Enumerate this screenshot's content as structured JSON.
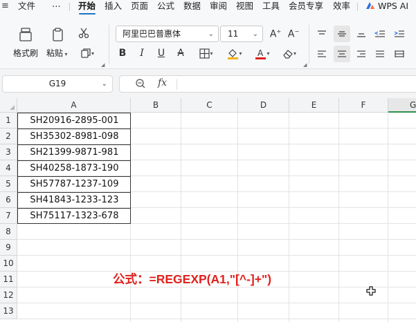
{
  "menu": {
    "items": [
      {
        "key": "file",
        "label": "文件"
      },
      {
        "key": "more",
        "label": "⋯"
      },
      {
        "key": "home",
        "label": "开始"
      },
      {
        "key": "insert",
        "label": "插入"
      },
      {
        "key": "page",
        "label": "页面"
      },
      {
        "key": "formula",
        "label": "公式"
      },
      {
        "key": "data",
        "label": "数据"
      },
      {
        "key": "review",
        "label": "审阅"
      },
      {
        "key": "view",
        "label": "视图"
      },
      {
        "key": "tools",
        "label": "工具"
      },
      {
        "key": "member",
        "label": "会员专享"
      },
      {
        "key": "efficiency",
        "label": "效率"
      },
      {
        "key": "wpsai",
        "label": "WPS AI"
      }
    ],
    "active": "开始"
  },
  "ribbon": {
    "format_painter": "格式刷",
    "paste": "粘贴",
    "font_name": "阿里巴巴普惠体",
    "font_size": "11",
    "accent_underline": "#1a73c9",
    "font_color": "#e0201b",
    "highlight_color": "#f3b11b"
  },
  "formula_bar": {
    "cell_ref": "G19",
    "fx_label": "fx",
    "formula": ""
  },
  "sheet": {
    "columns": [
      "A",
      "B",
      "C",
      "D",
      "E",
      "F",
      "G"
    ],
    "rows": [
      "1",
      "2",
      "3",
      "4",
      "5",
      "6",
      "7",
      "8",
      "9",
      "10",
      "11",
      "12",
      "13"
    ],
    "cells_A": [
      "SH20916-2895-001",
      "SH35302-8981-098",
      "SH21399-9871-981",
      "SH40258-1873-190",
      "SH57787-1237-109",
      "SH41843-1233-123",
      "SH75117-1323-678"
    ],
    "selected_column": "G"
  },
  "annotation": {
    "text": "公式：=REGEXP(A1,\"[^-]+\")",
    "color": "#e0201b"
  }
}
